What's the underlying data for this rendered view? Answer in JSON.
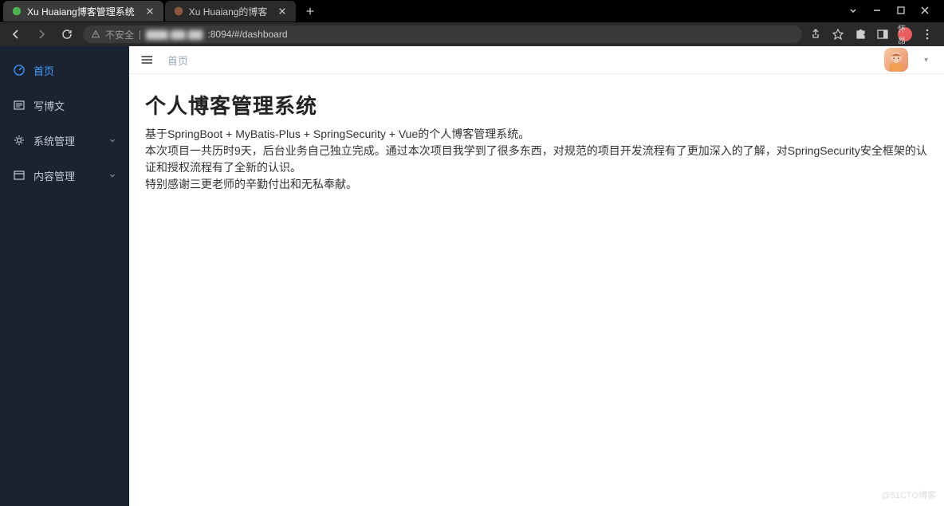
{
  "browser": {
    "tabs": [
      {
        "title": "Xu Huaiang博客管理系统",
        "active": true
      },
      {
        "title": "Xu Huaiang的博客",
        "active": false
      }
    ],
    "address": {
      "warn_label": "不安全",
      "host_blurred": "▇▇▇.▇▇.▇▇",
      "path": ":8094/#/dashboard"
    },
    "user_badge": "怀昂"
  },
  "sidebar": {
    "items": [
      {
        "label": "首页",
        "icon": "dashboard-icon",
        "active": true,
        "expandable": false
      },
      {
        "label": "写博文",
        "icon": "edit-icon",
        "active": false,
        "expandable": false
      },
      {
        "label": "系统管理",
        "icon": "gear-icon",
        "active": false,
        "expandable": true
      },
      {
        "label": "内容管理",
        "icon": "content-icon",
        "active": false,
        "expandable": true
      }
    ]
  },
  "topbar": {
    "breadcrumb": "首页"
  },
  "content": {
    "title": "个人博客管理系统",
    "line1": "基于SpringBoot + MyBatis-Plus + SpringSecurity + Vue的个人博客管理系统。",
    "line2": "本次项目一共历时9天，后台业务自己独立完成。通过本次项目我学到了很多东西，对规范的项目开发流程有了更加深入的了解，对SpringSecurity安全框架的认证和授权流程有了全新的认识。",
    "line3": "特别感谢三更老师的辛勤付出和无私奉献。"
  },
  "watermark": "@51CTO博客"
}
